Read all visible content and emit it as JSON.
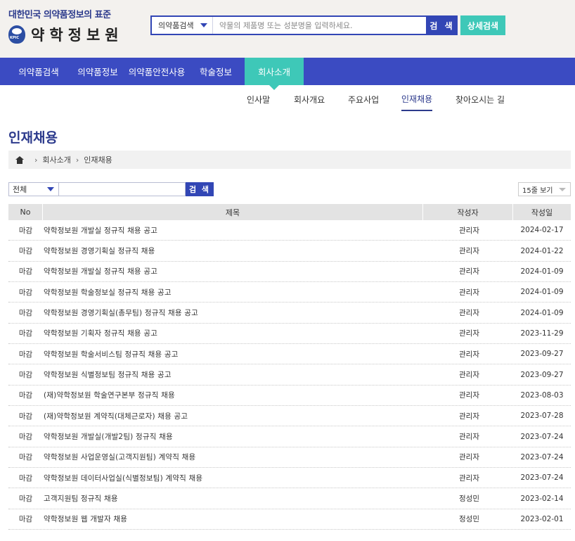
{
  "header": {
    "tagline": "대한민국 의약품정보의 표준",
    "brand": "약학정보원",
    "search": {
      "category": "의약품검색",
      "placeholder": "약물의 제품명 또는 성분명을 입력하세요.",
      "button": "검 색",
      "detail_button": "상세검색"
    }
  },
  "nav": {
    "items": [
      {
        "label": "의약품검색"
      },
      {
        "label": "의약품정보"
      },
      {
        "label": "의약품안전사용"
      },
      {
        "label": "학술정보"
      },
      {
        "label": "회사소개"
      }
    ],
    "active": "회사소개"
  },
  "subnav": {
    "items": [
      {
        "label": "인사말"
      },
      {
        "label": "회사개요"
      },
      {
        "label": "주요사업"
      },
      {
        "label": "인재채용"
      },
      {
        "label": "찾아오시는 길"
      }
    ],
    "active": "인재채용"
  },
  "page": {
    "title": "인재채용",
    "breadcrumb": [
      "회사소개",
      "인재채용"
    ]
  },
  "filter": {
    "scope": "전체",
    "query": "",
    "button": "검 색",
    "page_size": "15줄 보기"
  },
  "table": {
    "headers": {
      "no": "No",
      "title": "제목",
      "author": "작성자",
      "date": "작성일"
    },
    "rows": [
      {
        "status": "마감",
        "title": "약학정보원 개발실 정규직 채용 공고",
        "author": "관리자",
        "date": "2024-02-17"
      },
      {
        "status": "마감",
        "title": "약학정보원 경영기획실 정규직 채용",
        "author": "관리자",
        "date": "2024-01-22"
      },
      {
        "status": "마감",
        "title": "약학정보원 개발실 정규직 채용 공고",
        "author": "관리자",
        "date": "2024-01-09"
      },
      {
        "status": "마감",
        "title": "약학정보원 학술정보실 정규직 채용 공고",
        "author": "관리자",
        "date": "2024-01-09"
      },
      {
        "status": "마감",
        "title": "약학정보원 경영기획실(총무팀) 정규직 채용 공고",
        "author": "관리자",
        "date": "2024-01-09"
      },
      {
        "status": "마감",
        "title": "약학정보원 기획자 정규직 채용 공고",
        "author": "관리자",
        "date": "2023-11-29"
      },
      {
        "status": "마감",
        "title": "약학정보원 학술서비스팀 정규직 채용 공고",
        "author": "관리자",
        "date": "2023-09-27"
      },
      {
        "status": "마감",
        "title": "약학정보원 식별정보팀 정규직 채용 공고",
        "author": "관리자",
        "date": "2023-09-27"
      },
      {
        "status": "마감",
        "title": "(재)약학정보원 학술연구본부 정규직 채용",
        "author": "관리자",
        "date": "2023-08-03"
      },
      {
        "status": "마감",
        "title": "(재)약학정보원 계약직(대체근로자) 채용 공고",
        "author": "관리자",
        "date": "2023-07-28"
      },
      {
        "status": "마감",
        "title": "약학정보원 개발실(개발2팀) 정규직 채용",
        "author": "관리자",
        "date": "2023-07-24"
      },
      {
        "status": "마감",
        "title": "약학정보원 사업운영실(고객지원팀) 계약직 채용",
        "author": "관리자",
        "date": "2023-07-24"
      },
      {
        "status": "마감",
        "title": "약학정보원 데이터사업실(식별정보팀) 계약직 채용",
        "author": "관리자",
        "date": "2023-07-24"
      },
      {
        "status": "마감",
        "title": "고객지원팀 정규직 채용",
        "author": "정성민",
        "date": "2023-02-14"
      },
      {
        "status": "마감",
        "title": "약학정보원 웹 개발자 채용",
        "author": "정성민",
        "date": "2023-02-01"
      }
    ]
  }
}
